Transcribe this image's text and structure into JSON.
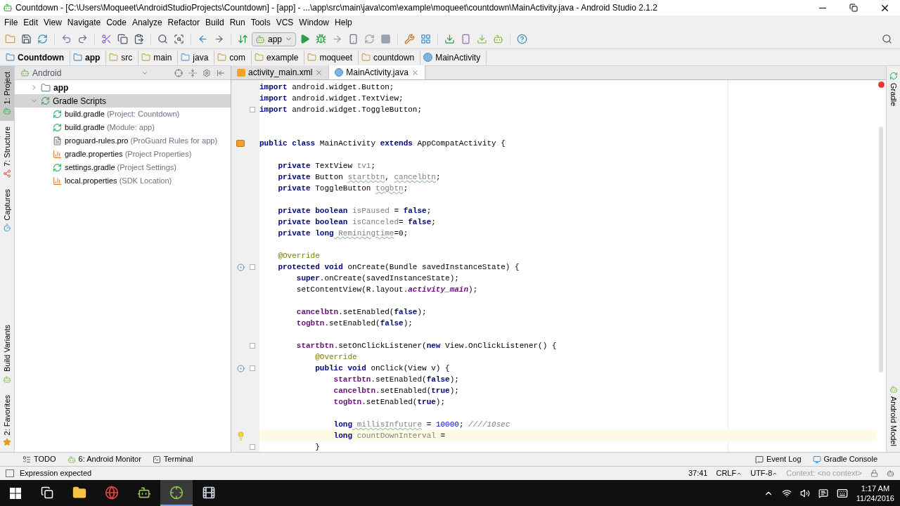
{
  "window": {
    "title": "Countdown - [C:\\Users\\Moqueet\\AndroidStudioProjects\\Countdown] - [app] - ...\\app\\src\\main\\java\\com\\example\\moqueet\\countdown\\MainActivity.java - Android Studio 2.1.2"
  },
  "menu": [
    "File",
    "Edit",
    "View",
    "Navigate",
    "Code",
    "Analyze",
    "Refactor",
    "Build",
    "Run",
    "Tools",
    "VCS",
    "Window",
    "Help"
  ],
  "toolbar": {
    "run_config": "app"
  },
  "breadcrumbs": [
    {
      "label": "Countdown",
      "kind": "project"
    },
    {
      "label": "app",
      "kind": "module"
    },
    {
      "label": "src",
      "kind": "folder"
    },
    {
      "label": "main",
      "kind": "folder"
    },
    {
      "label": "java",
      "kind": "source"
    },
    {
      "label": "com",
      "kind": "folder"
    },
    {
      "label": "example",
      "kind": "folder"
    },
    {
      "label": "moqueet",
      "kind": "folder"
    },
    {
      "label": "countdown",
      "kind": "folder"
    },
    {
      "label": "MainActivity",
      "kind": "class"
    }
  ],
  "left_tool_windows_top": [
    {
      "label": "1: Project",
      "kind": "project",
      "selected": true
    },
    {
      "label": "7: Structure",
      "kind": "structure",
      "selected": false
    },
    {
      "label": "Captures",
      "kind": "captures",
      "selected": false
    }
  ],
  "left_tool_windows_bottom": [
    {
      "label": "Build Variants",
      "kind": "android",
      "selected": false
    },
    {
      "label": "2: Favorites",
      "kind": "star",
      "selected": false
    }
  ],
  "project_panel": {
    "view": "Android",
    "tree": [
      {
        "label": "app",
        "kind": "module",
        "expanded": false,
        "selected": false
      },
      {
        "label": "Gradle Scripts",
        "kind": "gradle",
        "expanded": true,
        "selected": true,
        "children": [
          {
            "label": "build.gradle",
            "note": "(Project: Countdown)",
            "kind": "gradle"
          },
          {
            "label": "build.gradle",
            "note": "(Module: app)",
            "kind": "gradle"
          },
          {
            "label": "proguard-rules.pro",
            "note": "(ProGuard Rules for app)",
            "kind": "text"
          },
          {
            "label": "gradle.properties",
            "note": "(Project Properties)",
            "kind": "properties"
          },
          {
            "label": "settings.gradle",
            "note": "(Project Settings)",
            "kind": "gradle"
          },
          {
            "label": "local.properties",
            "note": "(SDK Location)",
            "kind": "properties"
          }
        ]
      }
    ]
  },
  "editor_tabs": [
    {
      "label": "activity_main.xml",
      "kind": "xml",
      "selected": false
    },
    {
      "label": "MainActivity.java",
      "kind": "class",
      "selected": true
    }
  ],
  "code_lines": [
    {
      "kind": "plain",
      "fold": false,
      "current": false,
      "tokens": [
        {
          "t": "import",
          "kind": "keyword"
        },
        {
          "t": " android.widget.Button;",
          "kind": "plain"
        }
      ]
    },
    {
      "kind": "plain",
      "fold": false,
      "current": false,
      "tokens": [
        {
          "t": "import",
          "kind": "keyword"
        },
        {
          "t": " android.widget.TextView;",
          "kind": "plain"
        }
      ]
    },
    {
      "kind": "plain",
      "fold": true,
      "current": false,
      "tokens": [
        {
          "t": "import",
          "kind": "keyword"
        },
        {
          "t": " android.widget.ToggleButton;",
          "kind": "plain"
        }
      ]
    },
    {
      "kind": "blank",
      "fold": false,
      "current": false
    },
    {
      "kind": "blank",
      "fold": false,
      "current": false
    },
    {
      "kind": "class",
      "fold": false,
      "current": false,
      "tokens": [
        {
          "t": "public class",
          "kind": "keyword"
        },
        {
          "t": " MainActivity ",
          "kind": "plain"
        },
        {
          "t": "extends",
          "kind": "keyword"
        },
        {
          "t": " AppCompatActivity {",
          "kind": "plain"
        }
      ]
    },
    {
      "kind": "blank",
      "fold": false,
      "current": false
    },
    {
      "kind": "plain",
      "fold": false,
      "current": false,
      "tokens": [
        {
          "t": "    private",
          "kind": "keyword"
        },
        {
          "t": " TextView ",
          "kind": "plain"
        },
        {
          "t": "tv1",
          "kind": "unused"
        },
        {
          "t": ";",
          "kind": "plain"
        }
      ]
    },
    {
      "kind": "plain",
      "fold": false,
      "current": false,
      "tokens": [
        {
          "t": "    private",
          "kind": "keyword"
        },
        {
          "t": " Button ",
          "kind": "plain"
        },
        {
          "t": "startbtn",
          "kind": "unused-typo"
        },
        {
          "t": ", ",
          "kind": "plain"
        },
        {
          "t": "cancelbtn",
          "kind": "unused-typo"
        },
        {
          "t": ";",
          "kind": "plain"
        }
      ]
    },
    {
      "kind": "plain",
      "fold": false,
      "current": false,
      "tokens": [
        {
          "t": "    private",
          "kind": "keyword"
        },
        {
          "t": " ToggleButton ",
          "kind": "plain"
        },
        {
          "t": "togbtn",
          "kind": "unused-typo"
        },
        {
          "t": ";",
          "kind": "plain"
        }
      ]
    },
    {
      "kind": "blank",
      "fold": false,
      "current": false
    },
    {
      "kind": "plain",
      "fold": false,
      "current": false,
      "tokens": [
        {
          "t": "    private boolean",
          "kind": "keyword"
        },
        {
          "t": " isPaused",
          "kind": "unused"
        },
        {
          "t": " = ",
          "kind": "plain"
        },
        {
          "t": "false",
          "kind": "keyword"
        },
        {
          "t": ";",
          "kind": "plain"
        }
      ]
    },
    {
      "kind": "plain",
      "fold": false,
      "current": false,
      "tokens": [
        {
          "t": "    private boolean",
          "kind": "keyword"
        },
        {
          "t": " isCanceled",
          "kind": "unused"
        },
        {
          "t": "= ",
          "kind": "plain"
        },
        {
          "t": "false",
          "kind": "keyword"
        },
        {
          "t": ";",
          "kind": "plain"
        }
      ]
    },
    {
      "kind": "plain",
      "fold": false,
      "current": false,
      "tokens": [
        {
          "t": "    private long",
          "kind": "keyword"
        },
        {
          "t": " Reminingtime",
          "kind": "unused-typo"
        },
        {
          "t": "=0;",
          "kind": "plain"
        }
      ]
    },
    {
      "kind": "blank",
      "fold": false,
      "current": false
    },
    {
      "kind": "plain",
      "fold": false,
      "current": false,
      "tokens": [
        {
          "t": "    @Override",
          "kind": "annotation"
        }
      ]
    },
    {
      "kind": "override",
      "fold": true,
      "current": false,
      "tokens": [
        {
          "t": "    protected void",
          "kind": "keyword"
        },
        {
          "t": " onCreate(Bundle savedInstanceState) {",
          "kind": "plain"
        }
      ]
    },
    {
      "kind": "plain",
      "fold": false,
      "current": false,
      "tokens": [
        {
          "t": "        super",
          "kind": "keyword"
        },
        {
          "t": ".onCreate(savedInstanceState);",
          "kind": "plain"
        }
      ]
    },
    {
      "kind": "plain",
      "fold": false,
      "current": false,
      "tokens": [
        {
          "t": "        setContentView(R.layout.",
          "kind": "plain"
        },
        {
          "t": "activity_main",
          "kind": "static"
        },
        {
          "t": ");",
          "kind": "plain"
        }
      ]
    },
    {
      "kind": "blank",
      "fold": false,
      "current": false
    },
    {
      "kind": "plain",
      "fold": false,
      "current": false,
      "tokens": [
        {
          "t": "        cancelbtn",
          "kind": "field"
        },
        {
          "t": ".setEnabled(",
          "kind": "plain"
        },
        {
          "t": "false",
          "kind": "keyword"
        },
        {
          "t": ");",
          "kind": "plain"
        }
      ]
    },
    {
      "kind": "plain",
      "fold": false,
      "current": false,
      "tokens": [
        {
          "t": "        togbtn",
          "kind": "field"
        },
        {
          "t": ".setEnabled(",
          "kind": "plain"
        },
        {
          "t": "false",
          "kind": "keyword"
        },
        {
          "t": ");",
          "kind": "plain"
        }
      ]
    },
    {
      "kind": "blank",
      "fold": false,
      "current": false
    },
    {
      "kind": "plain",
      "fold": true,
      "current": false,
      "tokens": [
        {
          "t": "        startbtn",
          "kind": "field"
        },
        {
          "t": ".setOnClickListener(",
          "kind": "plain"
        },
        {
          "t": "new",
          "kind": "keyword"
        },
        {
          "t": " View.OnClickListener() {",
          "kind": "plain"
        }
      ]
    },
    {
      "kind": "plain",
      "fold": false,
      "current": false,
      "tokens": [
        {
          "t": "            @Override",
          "kind": "annotation"
        }
      ]
    },
    {
      "kind": "override",
      "fold": true,
      "current": false,
      "tokens": [
        {
          "t": "            public void",
          "kind": "keyword"
        },
        {
          "t": " onClick(View v) {",
          "kind": "plain"
        }
      ]
    },
    {
      "kind": "plain",
      "fold": false,
      "current": false,
      "tokens": [
        {
          "t": "                startbtn",
          "kind": "field"
        },
        {
          "t": ".setEnabled(",
          "kind": "plain"
        },
        {
          "t": "false",
          "kind": "keyword"
        },
        {
          "t": ");",
          "kind": "plain"
        }
      ]
    },
    {
      "kind": "plain",
      "fold": false,
      "current": false,
      "tokens": [
        {
          "t": "                cancelbtn",
          "kind": "field"
        },
        {
          "t": ".setEnabled(",
          "kind": "plain"
        },
        {
          "t": "true",
          "kind": "keyword"
        },
        {
          "t": ");",
          "kind": "plain"
        }
      ]
    },
    {
      "kind": "plain",
      "fold": false,
      "current": false,
      "tokens": [
        {
          "t": "                togbtn",
          "kind": "field"
        },
        {
          "t": ".setEnabled(",
          "kind": "plain"
        },
        {
          "t": "true",
          "kind": "keyword"
        },
        {
          "t": ");",
          "kind": "plain"
        }
      ]
    },
    {
      "kind": "blank",
      "fold": false,
      "current": false
    },
    {
      "kind": "plain",
      "fold": false,
      "current": false,
      "tokens": [
        {
          "t": "                long",
          "kind": "keyword"
        },
        {
          "t": " millisInfuture",
          "kind": "unused-typo"
        },
        {
          "t": " = ",
          "kind": "plain"
        },
        {
          "t": "10000",
          "kind": "number"
        },
        {
          "t": "; ",
          "kind": "plain"
        },
        {
          "t": "////10sec",
          "kind": "comment"
        }
      ]
    },
    {
      "kind": "bulb",
      "fold": false,
      "current": true,
      "tokens": [
        {
          "t": "                long",
          "kind": "keyword"
        },
        {
          "t": " countDownInterval",
          "kind": "unused"
        },
        {
          "t": " =",
          "kind": "plain"
        }
      ]
    },
    {
      "kind": "plain",
      "fold": true,
      "current": false,
      "tokens": [
        {
          "t": "            }",
          "kind": "plain"
        }
      ]
    }
  ],
  "right_tool_windows": [
    {
      "label": "Gradle",
      "kind": "gradle"
    },
    {
      "label": "Android Model",
      "kind": "android"
    }
  ],
  "bottom_tools": {
    "left": [
      {
        "label": "TODO",
        "kind": "todo"
      },
      {
        "label": "6: Android Monitor",
        "kind": "android"
      },
      {
        "label": "Terminal",
        "kind": "terminal"
      }
    ],
    "right": [
      {
        "label": "Event Log",
        "kind": "log"
      },
      {
        "label": "Gradle Console",
        "kind": "console"
      }
    ]
  },
  "status_bar": {
    "message": "Expression expected",
    "position": "37:41",
    "line_separator": "CRLF",
    "encoding": "UTF-8",
    "context": "Context: <no context>"
  },
  "taskbar": {
    "apps": [
      {
        "kind": "task-view",
        "selected": false
      },
      {
        "kind": "folder",
        "selected": false
      },
      {
        "kind": "browser",
        "selected": false
      },
      {
        "kind": "android",
        "selected": false
      },
      {
        "kind": "studio",
        "selected": true
      },
      {
        "kind": "media",
        "selected": false
      }
    ],
    "time": "1:17 AM",
    "date": "11/24/2016"
  }
}
